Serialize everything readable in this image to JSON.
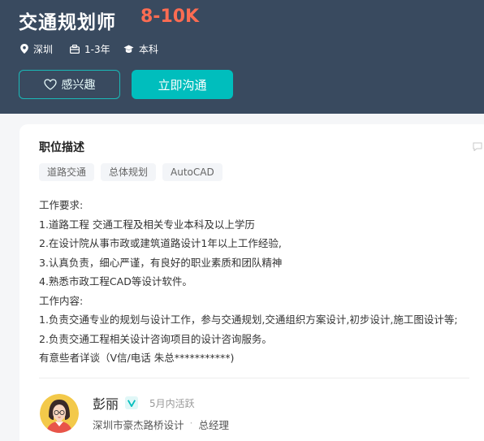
{
  "job": {
    "title": "交通规划师",
    "salary": "8-10K",
    "city": "深圳",
    "experience": "1-3年",
    "degree": "本科"
  },
  "actions": {
    "interest_label": "感兴趣",
    "chat_label": "立即沟通"
  },
  "description": {
    "section_title": "职位描述",
    "tags": [
      "道路交通",
      "总体规划",
      "AutoCAD"
    ],
    "lines": [
      "工作要求:",
      "1.道路工程 交通工程及相关专业本科及以上学历",
      "2.在设计院从事市政或建筑道路设计1年以上工作经验,",
      "3.认真负责，细心严谨，有良好的职业素质和团队精神",
      "4.熟悉市政工程CAD等设计软件。",
      "工作内容:",
      "1.负责交通专业的规划与设计工作，参与交通规划,交通组织方案设计,初步设计,施工图设计等;",
      "2.负责交通工程相关设计咨询项目的设计咨询服务。",
      "有意些者详谈（V信/电话 朱总***********)"
    ]
  },
  "recruiter": {
    "name": "彭丽",
    "active_status": "5月内活跃",
    "company": "深圳市豪杰路桥设计",
    "position": "总经理"
  },
  "colors": {
    "header_bg": "#394a5f",
    "accent": "#00bebd",
    "salary": "#fe6c52"
  },
  "icons": {
    "city": "location-pin-icon",
    "experience": "briefcase-icon",
    "degree": "graduation-cap-icon",
    "interest": "heart-icon",
    "message": "chat-bubble-icon",
    "verify": "verified-v-icon"
  }
}
